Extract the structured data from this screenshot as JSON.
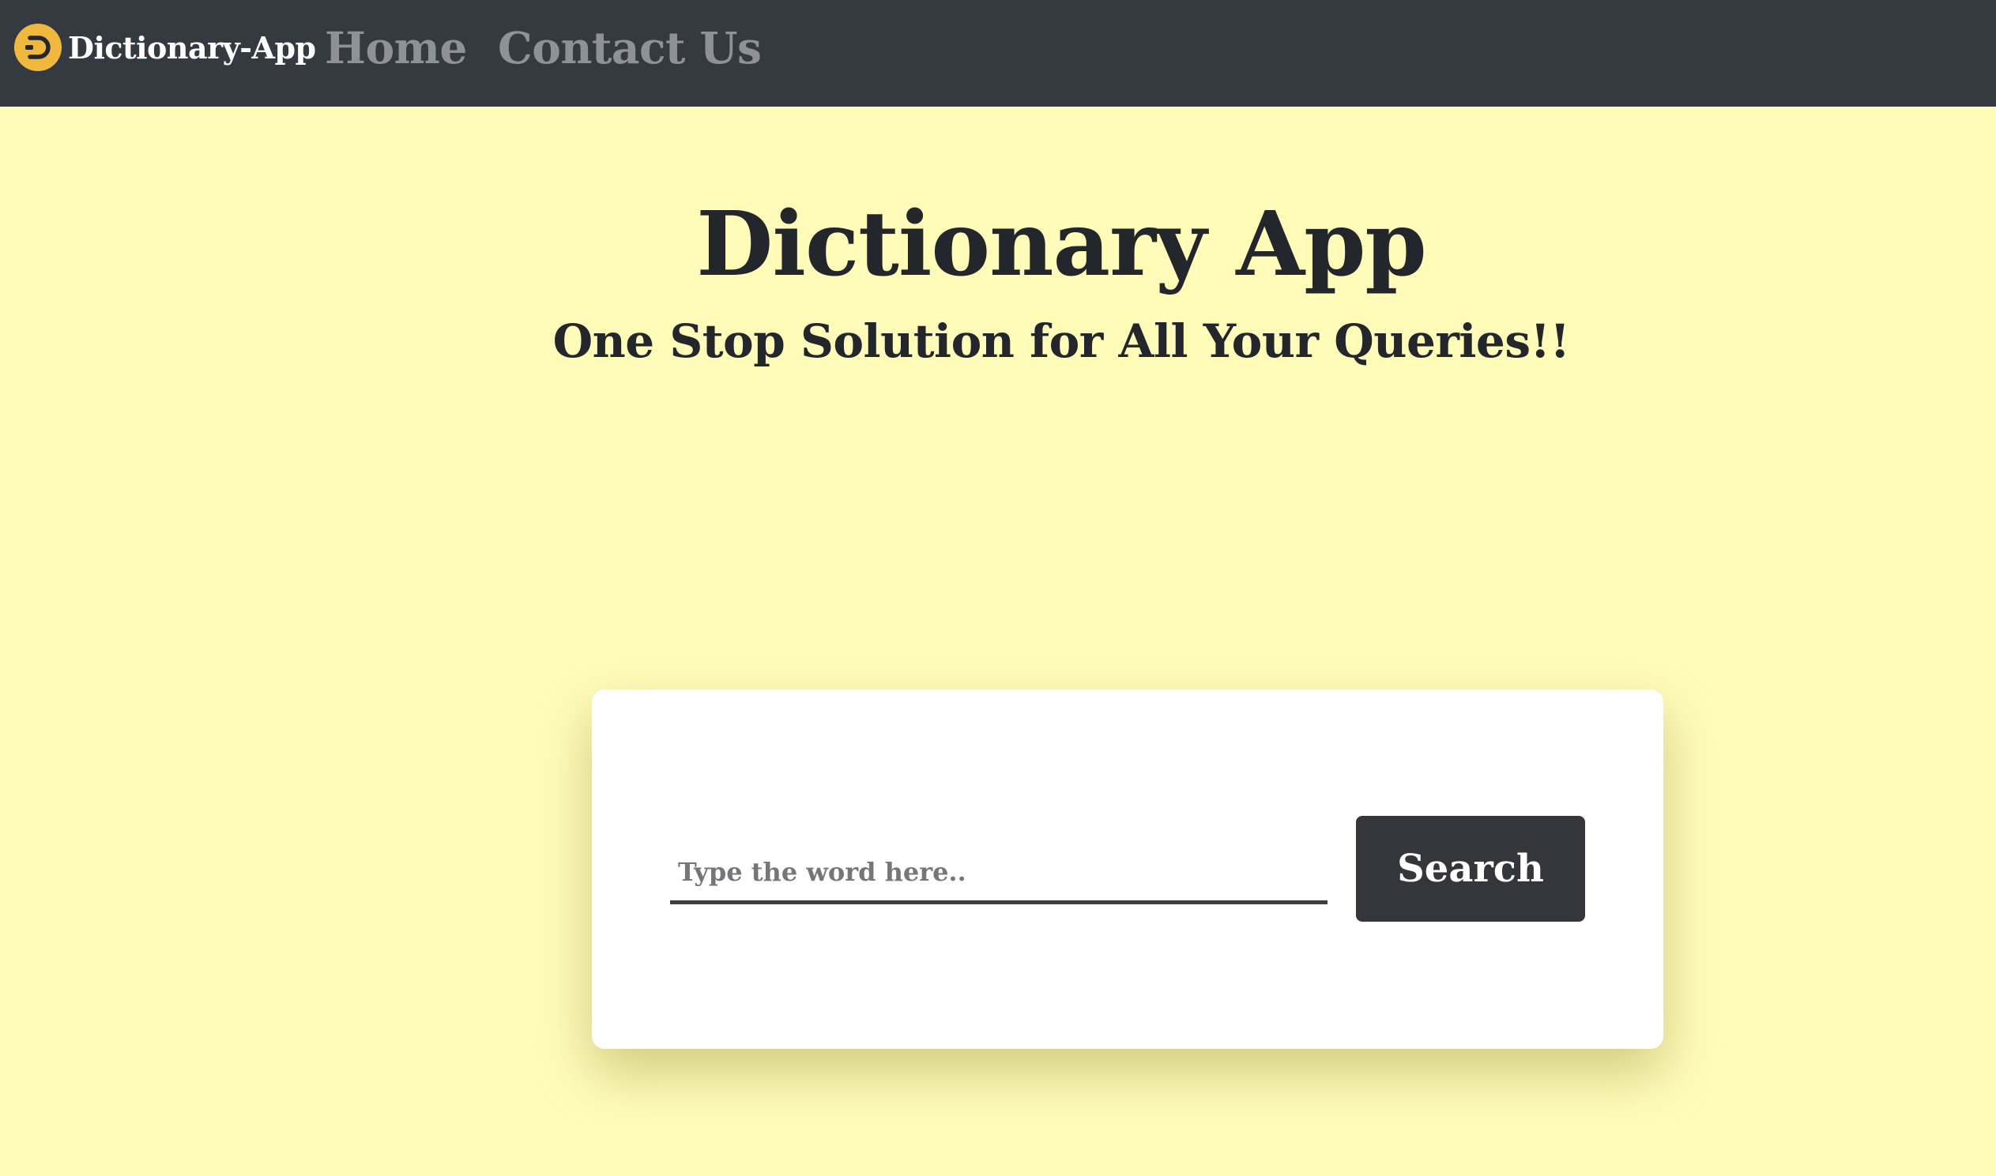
{
  "navbar": {
    "brand_label": "Dictionary-App",
    "brand_icon": "d-logo-icon",
    "links": [
      {
        "label": "Home"
      },
      {
        "label": "Contact Us"
      }
    ]
  },
  "hero": {
    "title": "Dictionary App",
    "subtitle": "One Stop Solution for All Your Queries!!"
  },
  "search": {
    "placeholder": "Type the word here..",
    "value": "",
    "button_label": "Search"
  },
  "colors": {
    "background": "#fffcba",
    "navbar": "#343a40",
    "brand_logo": "#f0b73f",
    "button": "#35363c",
    "nav_link": "#8e9297"
  }
}
